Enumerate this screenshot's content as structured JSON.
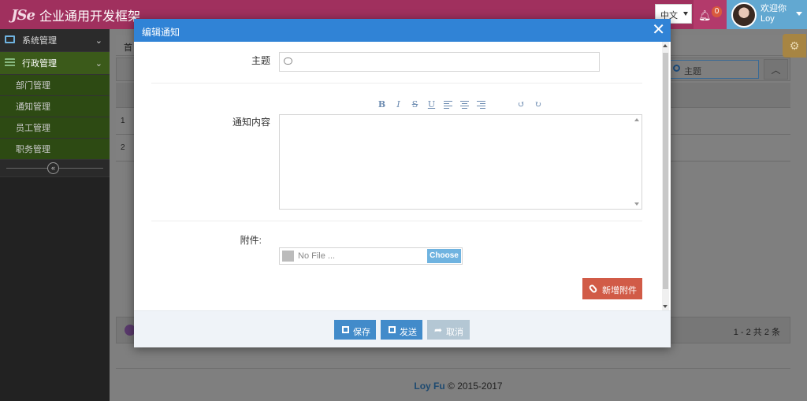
{
  "navbar": {
    "logo": "JSe",
    "title": "企业通用开发框架",
    "lang": "中文",
    "notification_count": "0",
    "welcome": "欢迎你",
    "username": "Loy"
  },
  "sidebar": {
    "items": [
      {
        "label": "系统管理"
      },
      {
        "label": "行政管理"
      }
    ],
    "sub_items": [
      "部门管理",
      "通知管理",
      "员工管理",
      "职务管理"
    ]
  },
  "background_page": {
    "breadcrumb": "首",
    "search_placeholder": "主题",
    "rows": [
      "1",
      "2"
    ],
    "paging": "1 - 2   共 2 条",
    "copyright_author": "Loy Fu",
    "copyright_rest": " © 2015-2017"
  },
  "modal": {
    "title": "编辑通知",
    "close": "✕",
    "subject_label": "主题",
    "subject_value": "",
    "content_label": "通知内容",
    "toolbar": [
      "B",
      "I",
      "S",
      "U"
    ],
    "undo": "↺",
    "redo": "↻",
    "attachment_label": "附件:",
    "file_placeholder": "No File ...",
    "file_choose": "Choose",
    "add_attachment": "新增附件",
    "save": "保存",
    "send": "发送",
    "cancel": "取消"
  },
  "colors": {
    "navbar": "#a0305e",
    "header": "#3083d6",
    "primary_button": "#428bca",
    "danger_button": "#d15b47"
  }
}
